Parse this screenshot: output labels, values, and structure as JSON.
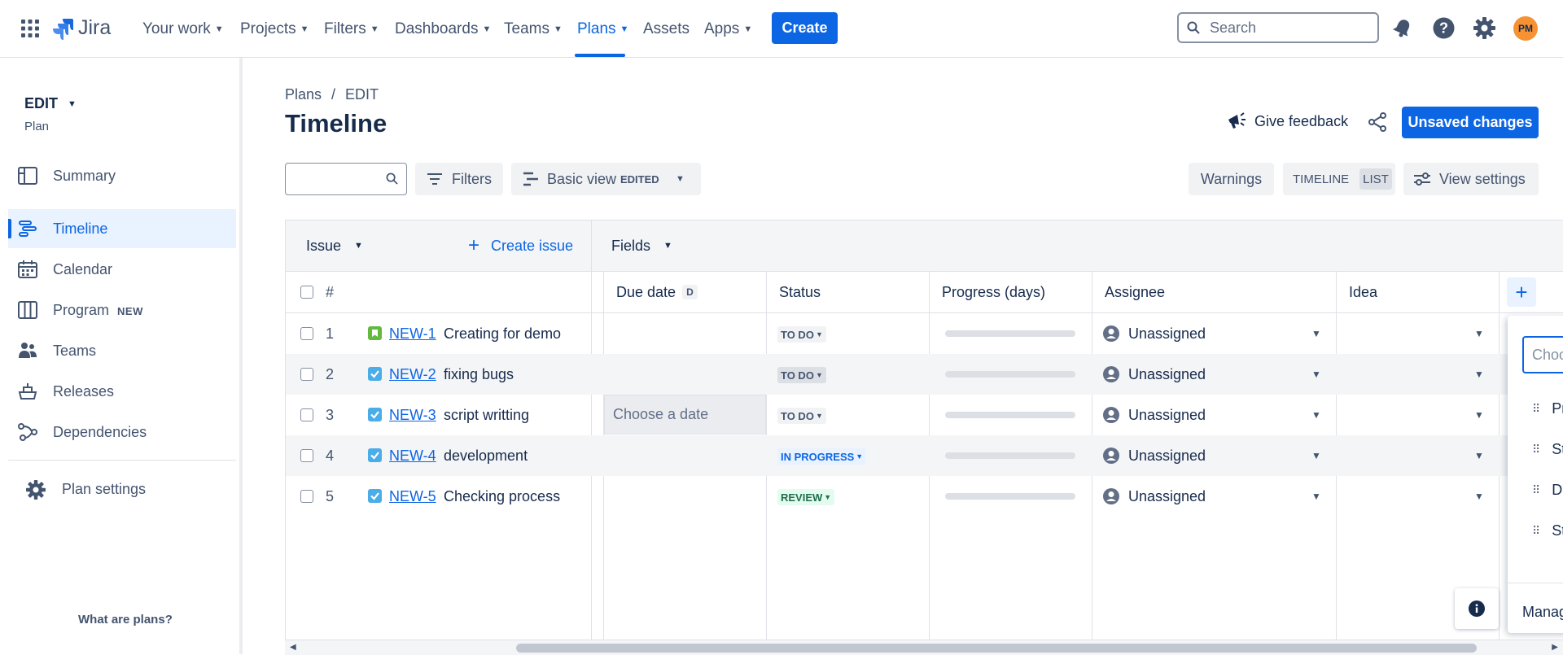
{
  "app": {
    "name": "Jira"
  },
  "nav": {
    "items": [
      {
        "label": "Your work"
      },
      {
        "label": "Projects"
      },
      {
        "label": "Filters"
      },
      {
        "label": "Dashboards"
      },
      {
        "label": "Teams"
      },
      {
        "label": "Plans",
        "active": true
      },
      {
        "label": "Assets"
      },
      {
        "label": "Apps"
      }
    ],
    "create_label": "Create",
    "search_placeholder": "Search",
    "avatar_initials": "PM"
  },
  "sidebar": {
    "plan_name": "EDIT",
    "plan_type": "Plan",
    "items": [
      {
        "label": "Summary",
        "icon": "summary-icon"
      },
      {
        "label": "Timeline",
        "icon": "timeline-icon",
        "active": true
      },
      {
        "label": "Calendar",
        "icon": "calendar-icon"
      },
      {
        "label": "Program",
        "icon": "program-icon",
        "badge": "NEW"
      },
      {
        "label": "Teams",
        "icon": "teams-icon"
      },
      {
        "label": "Releases",
        "icon": "releases-icon"
      },
      {
        "label": "Dependencies",
        "icon": "dependencies-icon"
      }
    ],
    "settings_label": "Plan settings",
    "footer_link": "What are plans?"
  },
  "header": {
    "breadcrumb": [
      "Plans",
      "/",
      "EDIT"
    ],
    "title": "Timeline",
    "feedback_label": "Give feedback",
    "unsaved_label": "Unsaved changes"
  },
  "toolbar": {
    "filters_label": "Filters",
    "view_label": "Basic view",
    "view_badge": "EDITED",
    "warnings_label": "Warnings",
    "timeline_label": "TIMELINE",
    "list_label": "LIST",
    "view_settings_label": "View settings"
  },
  "table": {
    "group_label": "Issue",
    "create_issue_label": "Create issue",
    "fields_label": "Fields",
    "columns": {
      "num": "#",
      "due_date": "Due date",
      "due_date_badge": "D",
      "status": "Status",
      "progress": "Progress (days)",
      "assignee": "Assignee",
      "idea": "Idea"
    },
    "date_placeholder": "Choose a date",
    "rows": [
      {
        "num": "1",
        "key": "NEW-1",
        "summary": "Creating for demo",
        "type": "story",
        "status": "TO DO",
        "assignee": "Unassigned",
        "progress": 0
      },
      {
        "num": "2",
        "key": "NEW-2",
        "summary": "fixing bugs",
        "type": "task",
        "status": "TO DO",
        "assignee": "Unassigned",
        "progress": 0
      },
      {
        "num": "3",
        "key": "NEW-3",
        "summary": "script writting",
        "type": "task",
        "status": "TO DO",
        "assignee": "Unassigned",
        "progress": 0
      },
      {
        "num": "4",
        "key": "NEW-4",
        "summary": "development",
        "type": "task",
        "status": "IN PROGRESS",
        "assignee": "Unassigned",
        "progress": 0
      },
      {
        "num": "5",
        "key": "NEW-5",
        "summary": "Checking process",
        "type": "task",
        "status": "REVIEW",
        "assignee": "Unassigned",
        "progress": 0
      }
    ]
  },
  "popup": {
    "input_placeholder": "Choo",
    "items": [
      "Pr",
      "St",
      "D",
      "St"
    ],
    "footer": "Manag"
  },
  "colors": {
    "brand_blue": "#0c66e4",
    "story_green": "#63ba3c",
    "task_blue": "#4bade8"
  }
}
